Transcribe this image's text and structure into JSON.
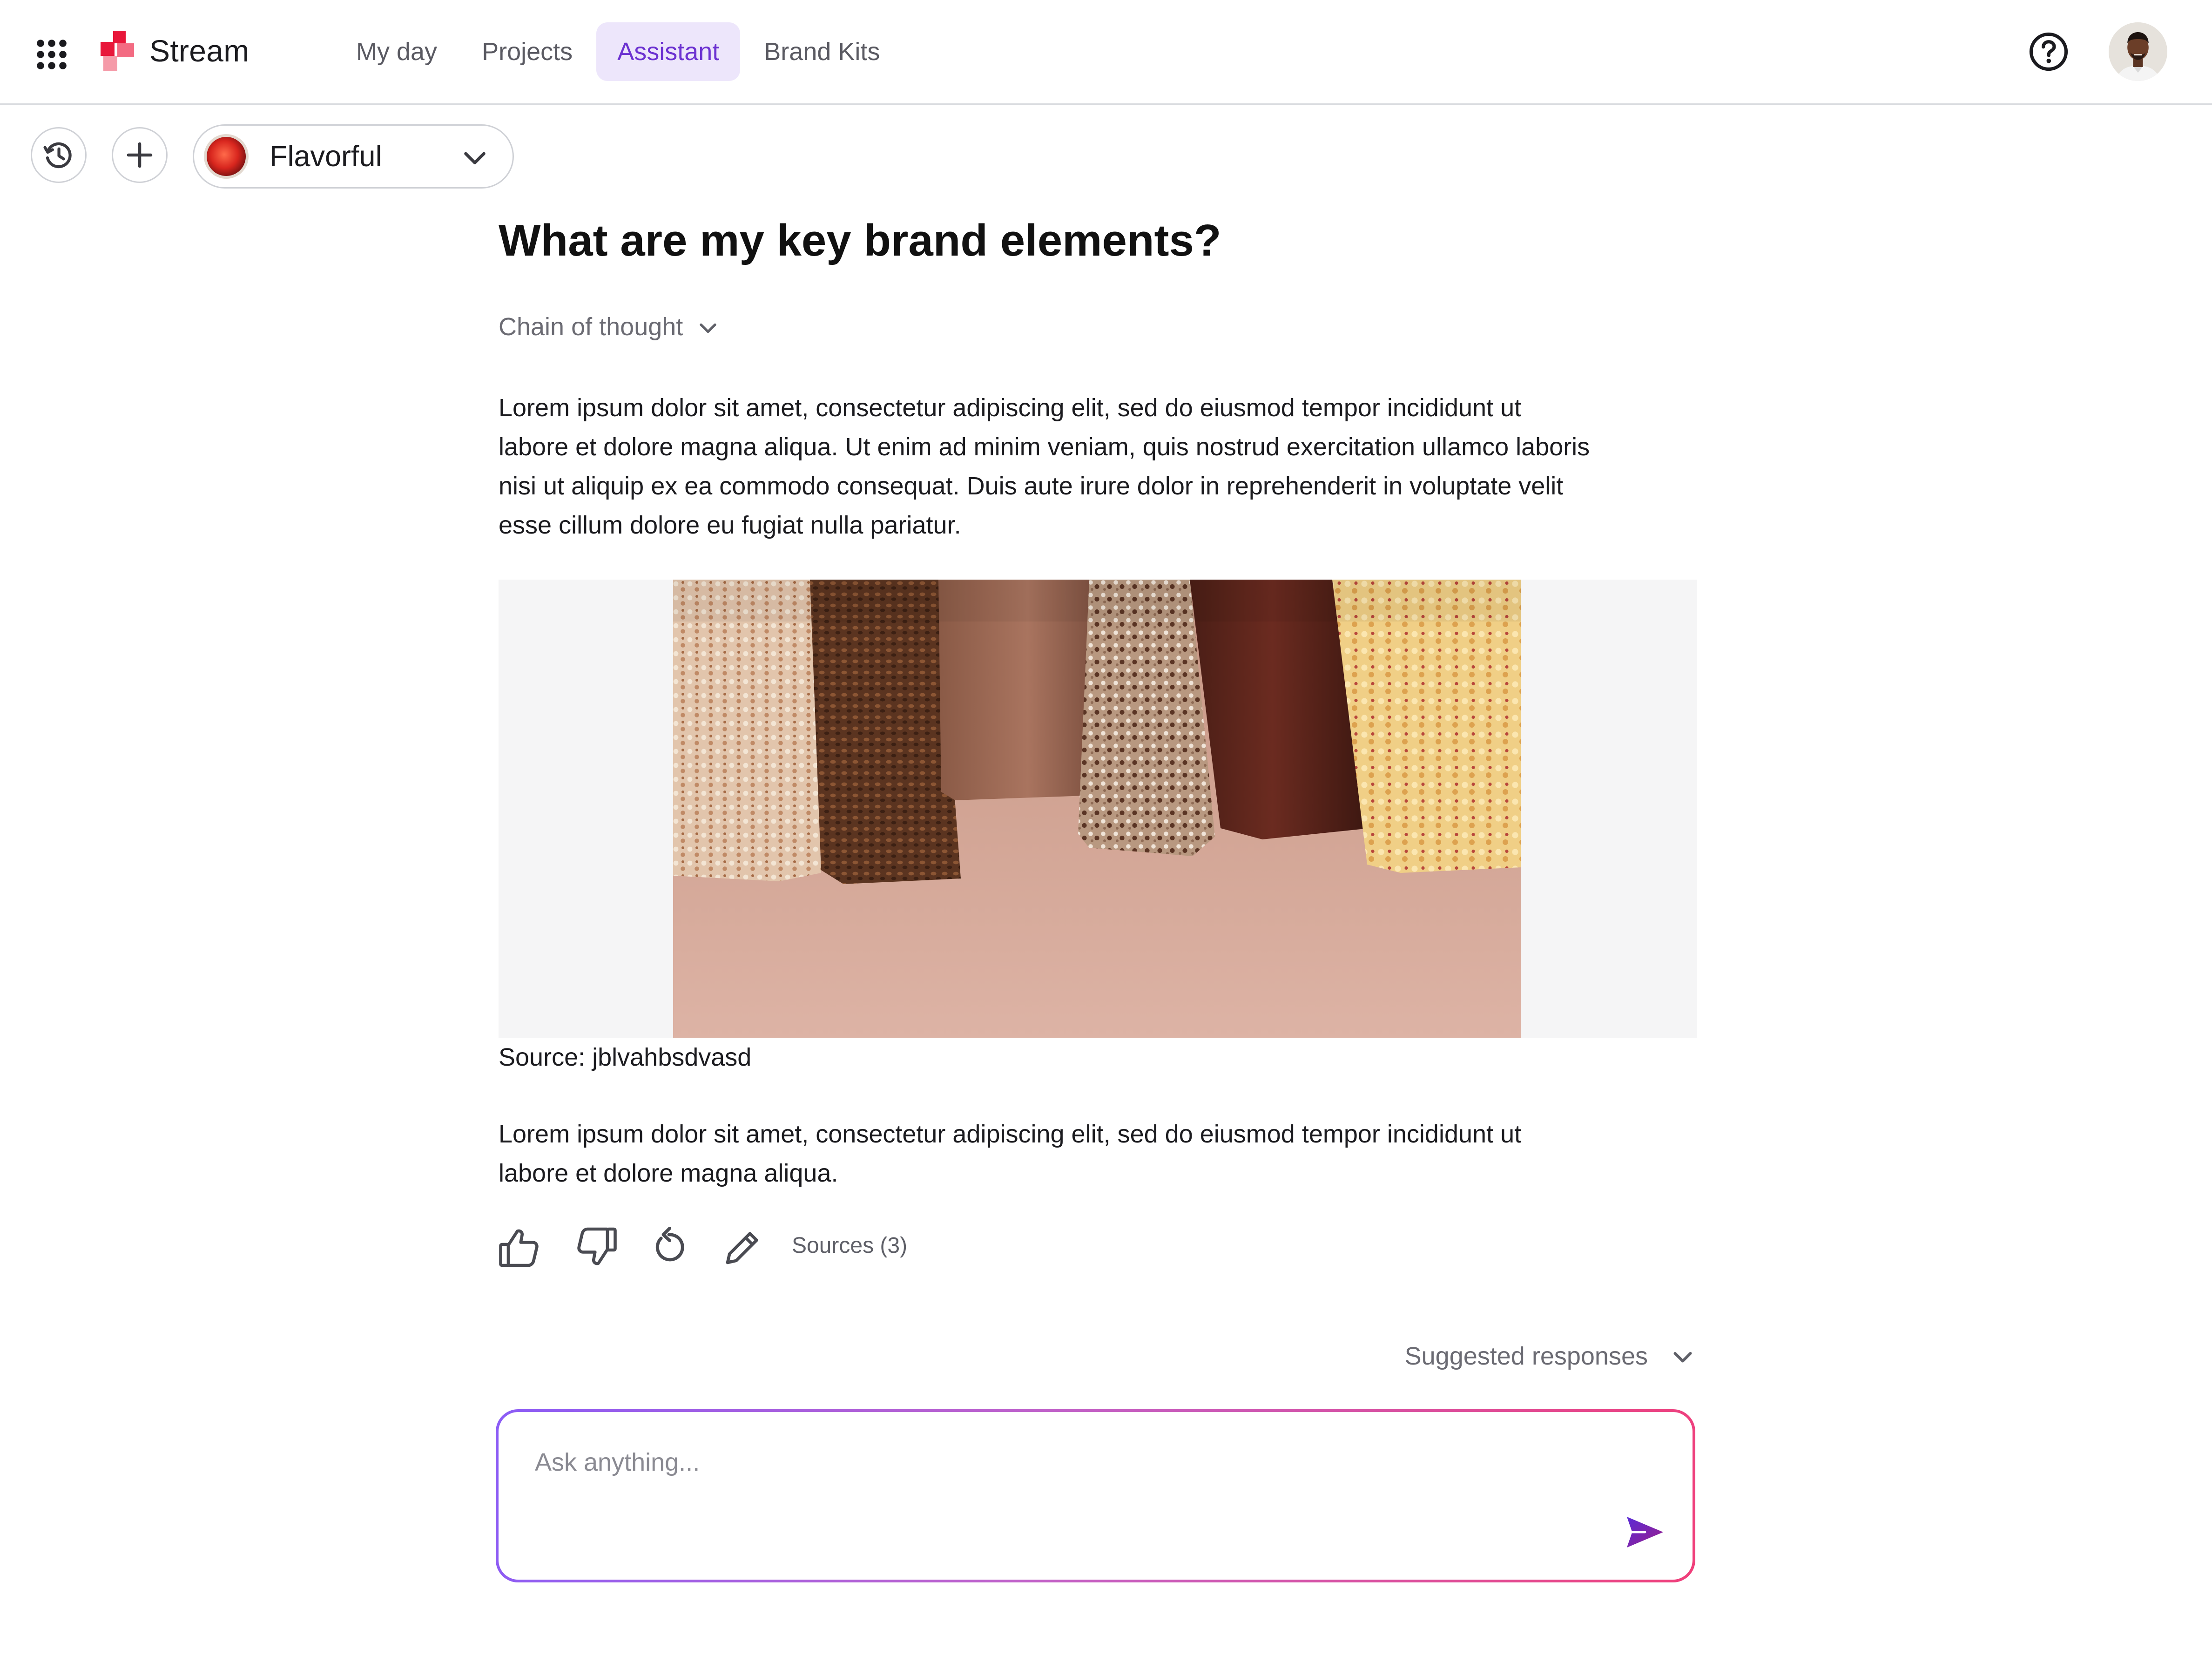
{
  "app": {
    "name": "Stream"
  },
  "nav": {
    "tabs": [
      {
        "label": "My day",
        "active": false
      },
      {
        "label": "Projects",
        "active": false
      },
      {
        "label": "Assistant",
        "active": true
      },
      {
        "label": "Brand Kits",
        "active": false
      }
    ]
  },
  "header": {
    "help_icon": "help-circle-icon",
    "avatar": "user-avatar"
  },
  "toolbar": {
    "history_icon": "history-icon",
    "new_icon": "plus-icon",
    "brand_kit": {
      "name": "Flavorful",
      "chevron": "chevron-down-icon"
    }
  },
  "conversation": {
    "question": "What are my key brand elements?",
    "chain_of_thought_label": "Chain of thought",
    "paragraph_1_lines": [
      "Lorem ipsum dolor sit amet, consectetur adipiscing elit, sed do eiusmod tempor incididunt ut",
      "labore et dolore magna aliqua. Ut enim ad minim veniam, quis nostrud exercitation ullamco laboris",
      "nisi ut aliquip ex ea commodo consequat. Duis aute irure dolor in reprehenderit in voluptate velit",
      "esse cillum dolore eu fugiat nulla pariatur."
    ],
    "source_text": "Source: jblvahbsdvasd",
    "paragraph_2_lines": [
      "Lorem ipsum dolor sit amet, consectetur adipiscing elit, sed do eiusmod tempor incididunt ut",
      "labore et dolore magna aliqua."
    ],
    "actions": {
      "icons": [
        "thumbs-up-icon",
        "thumbs-down-icon",
        "regenerate-icon",
        "edit-icon"
      ],
      "sources_label": "Sources (3)"
    },
    "suggested_label": "Suggested responses"
  },
  "composer": {
    "placeholder": "Ask anything...",
    "send_icon": "send-icon"
  },
  "colors": {
    "accent": "#6c32d1",
    "accent_bg": "#ede6fb",
    "logo_red": "#e8173a",
    "logo_pink": "#f59aa8",
    "gradient_start": "#8b5cf6",
    "gradient_end": "#f03f7a"
  }
}
